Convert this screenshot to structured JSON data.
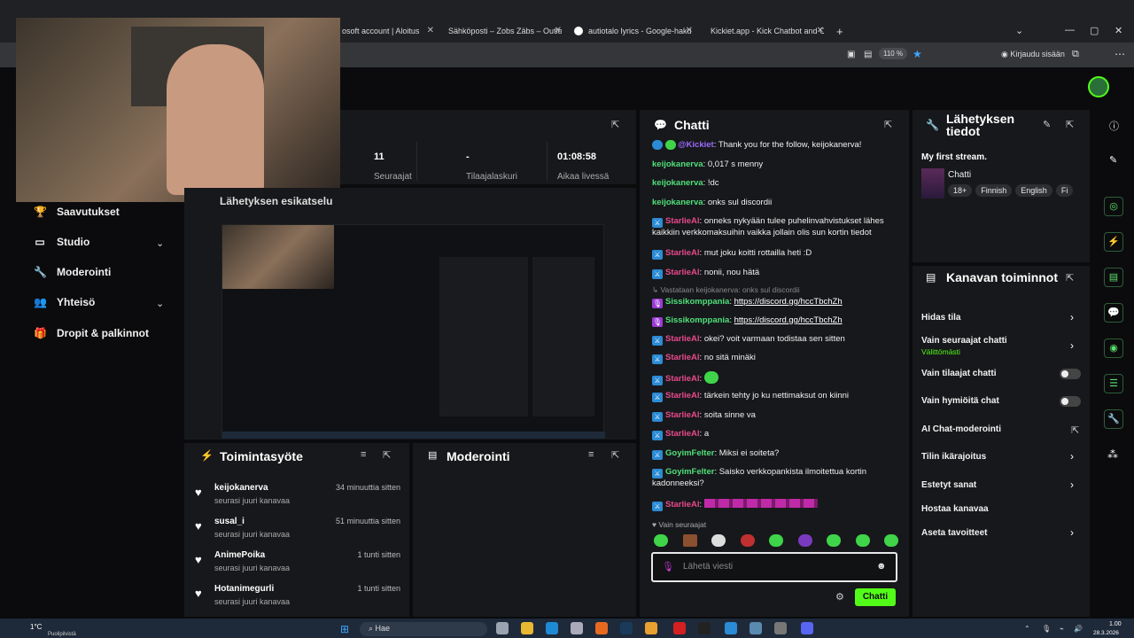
{
  "browser": {
    "tabs": [
      {
        "label": "osoft account | Aloitus",
        "icon": "microsoft-icon"
      },
      {
        "label": "Sähköposti – Zobs Zäbs – Outlo",
        "icon": "outlook-icon"
      },
      {
        "label": "autiotalo lyrics - Google-haku",
        "icon": "google-icon"
      },
      {
        "label": "Kickiet.app - Kick Chatbot and C",
        "icon": "kickiet-icon"
      }
    ],
    "new_tab": "+",
    "zoom": "110 %",
    "signin": "Kirjaudu sisään"
  },
  "sidebar": {
    "items": [
      {
        "label": "Saavutukset",
        "icon": "trophy-icon"
      },
      {
        "label": "Studio",
        "icon": "tv-icon",
        "expandable": true
      },
      {
        "label": "Moderointi",
        "icon": "wrench-icon"
      },
      {
        "label": "Yhteisö",
        "icon": "people-icon",
        "expandable": true
      },
      {
        "label": "Dropit & palkinnot",
        "icon": "gift-icon"
      }
    ]
  },
  "stats": [
    {
      "value": "11",
      "label": "Seuraajat"
    },
    {
      "value": "-",
      "label": "Tilaajalaskuri"
    },
    {
      "value": "01:08:58",
      "label": "Aikaa livessä"
    }
  ],
  "preview": {
    "title": "Lähetyksen esikatselu"
  },
  "activity": {
    "title": "Toimintasyöte",
    "items": [
      {
        "name": "keijokanerva",
        "sub": "seurasi juuri kanavaa",
        "time": "34 minuuttia sitten"
      },
      {
        "name": "susal_i",
        "sub": "seurasi juuri kanavaa",
        "time": "51 minuuttia sitten"
      },
      {
        "name": "AnimePoika",
        "sub": "seurasi juuri kanavaa",
        "time": "1 tunti sitten"
      },
      {
        "name": "Hotanimegurli",
        "sub": "seurasi juuri kanavaa",
        "time": "1 tunti sitten"
      }
    ]
  },
  "moderation": {
    "title": "Moderointi"
  },
  "chat": {
    "title": "Chatti",
    "messages": [
      {
        "user": "@Kickiet",
        "cls": "u-k",
        "text": "Thank you for the follow, keijokanerva!"
      },
      {
        "user": "keijokanerva",
        "cls": "u-k",
        "text": "0,017 s menny"
      },
      {
        "user": "keijokanerva",
        "cls": "u-k",
        "text": "!dc"
      },
      {
        "user": "keijokanerva",
        "cls": "u-k",
        "text": "onks sul discordii"
      },
      {
        "user": "StarlieAl",
        "cls": "u-s",
        "text": "onneks nykyään tulee puhelinvahvistukset lähes kaikkiin verkkomaksuihin vaikka jollain olis sun kortin tiedot"
      },
      {
        "user": "StarlieAl",
        "cls": "u-s",
        "text": "mut joku koitti rottailla heti :D"
      },
      {
        "user": "StarlieAl",
        "cls": "u-s",
        "text": "nonii, nou hätä"
      },
      {
        "reply": "Vastataan keijokanerva: onks sul discordii"
      },
      {
        "user": "Sissikomppania",
        "cls": "u-ss",
        "link": "https://discord.gg/hccTbchZh"
      },
      {
        "user": "Sissikomppania",
        "cls": "u-ss",
        "link": "https://discord.gg/hccTbchZh"
      },
      {
        "user": "StarlieAl",
        "cls": "u-s",
        "text": "okei? voit varmaan todistaa sen sitten"
      },
      {
        "user": "StarlieAl",
        "cls": "u-s",
        "text": "no sitä minäki"
      },
      {
        "user": "StarlieAl",
        "cls": "u-s",
        "emote": true
      },
      {
        "user": "StarlieAl",
        "cls": "u-s",
        "text": "tärkein tehty jo ku nettimaksut on kiinni"
      },
      {
        "user": "StarlieAl",
        "cls": "u-s",
        "text": "soita sinne va"
      },
      {
        "user": "StarlieAl",
        "cls": "u-s",
        "text": "a"
      },
      {
        "user": "GoyimFelter",
        "cls": "u-g",
        "text": "Miksi ei soiteta?"
      },
      {
        "user": "GoyimFelter",
        "cls": "u-g",
        "text": "Saisko verkkopankista ilmoitettua kortin kadonneeksi?"
      },
      {
        "user": "StarlieAl",
        "cls": "u-s",
        "emoterow": true
      }
    ],
    "followers_only": "Vain seuraajat",
    "input_placeholder": "Lähetä viesti",
    "send_label": "Chatti"
  },
  "stream_info": {
    "title": "Lähetyksen tiedot",
    "stream_title": "My first stream.",
    "category": "Chatti",
    "tags": [
      "18+",
      "Finnish",
      "English",
      "Fi"
    ]
  },
  "channel_actions": {
    "title": "Kanavan toiminnot",
    "options": [
      {
        "label": "Hidas tila",
        "control": "chevron"
      },
      {
        "label": "Vain seuraajat chatti",
        "sub": "Välittömästi",
        "control": "chevron"
      },
      {
        "label": "Vain tilaajat chatti",
        "control": "toggle"
      },
      {
        "label": "Vain hymiöitä chat",
        "control": "toggle"
      },
      {
        "label": "AI Chat-moderointi",
        "control": "external"
      },
      {
        "label": "Tilin ikärajoitus",
        "control": "chevron"
      },
      {
        "label": "Estetyt sanat",
        "control": "chevron"
      },
      {
        "label": "Hostaa kanavaa",
        "control": "none"
      },
      {
        "label": "Aseta tavoitteet",
        "control": "chevron"
      }
    ]
  },
  "taskbar": {
    "weather": "1°C",
    "weather_sub": "Puolipilvistä",
    "search": "Hae",
    "time": "1.00",
    "date": "28.3.2026"
  },
  "colors": {
    "accent": "#53fc18",
    "bg": "#0b0b0d",
    "panel": "#17181b"
  }
}
